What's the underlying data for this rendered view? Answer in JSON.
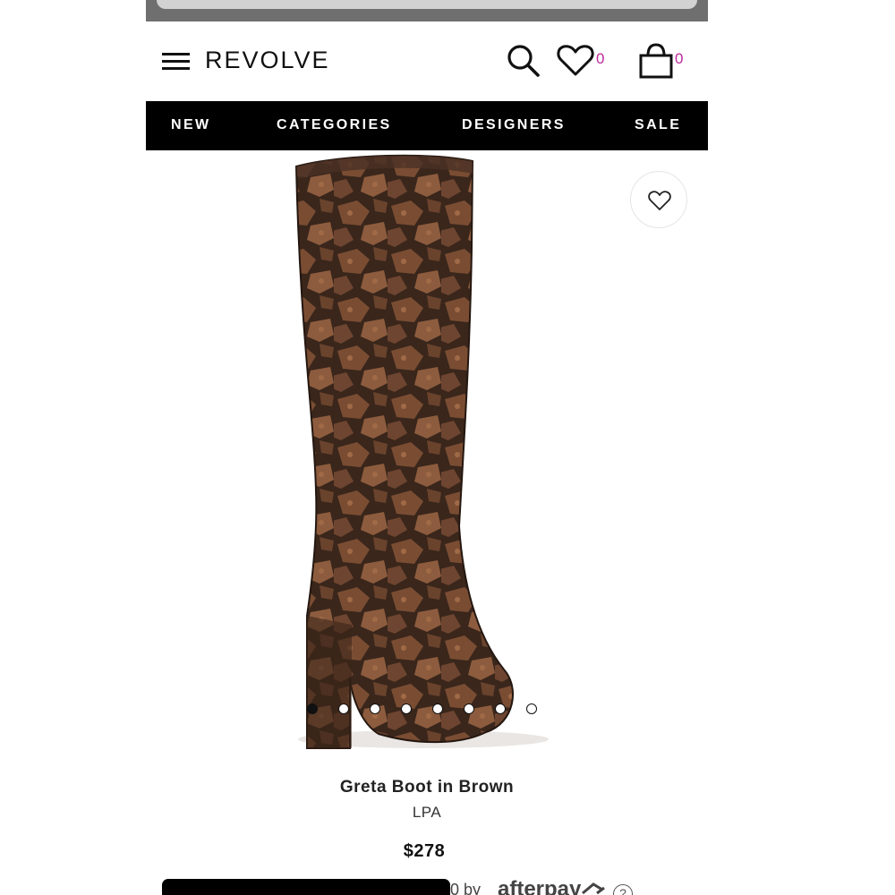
{
  "header": {
    "logo": "REVOLVE",
    "wishlist_count": "0",
    "bag_count": "0"
  },
  "nav": {
    "items": [
      "NEW",
      "CATEGORIES",
      "DESIGNERS",
      "SALE"
    ]
  },
  "gallery": {
    "image_count": 8,
    "active_index": 0
  },
  "product": {
    "title": "Greta Boot in Brown",
    "brand": "LPA",
    "price": "$278"
  },
  "payment": {
    "partial_text": "0 by",
    "provider": "afterpay",
    "help": "?"
  },
  "colors": {
    "accent_count": "#c0289c",
    "nav_bg": "#000000",
    "boot_dark": "#2b1d16",
    "boot_light": "#8a5a3c"
  },
  "icons": [
    "hamburger-menu-icon",
    "search-icon",
    "heart-icon",
    "shopping-bag-icon"
  ]
}
